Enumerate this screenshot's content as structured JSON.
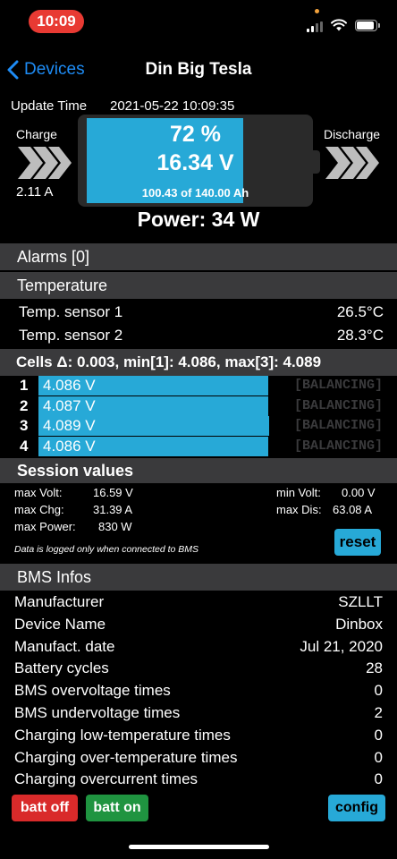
{
  "status_bar": {
    "time": "10:09"
  },
  "nav": {
    "back_label": "Devices",
    "title": "Din Big Tesla"
  },
  "summary": {
    "update_label": "Update Time",
    "update_value": "2021-05-22 10:09:35",
    "charge_label": "Charge",
    "charge_value": "2.11 A",
    "discharge_label": "Discharge",
    "percent": "72 %",
    "soc_fraction": 0.72,
    "voltage": "16.34 V",
    "capacity": "100.43 of 140.00 Ah",
    "power": "Power: 34 W"
  },
  "alarms": {
    "label": "Alarms [0]"
  },
  "temperature": {
    "label": "Temperature",
    "sensors": [
      {
        "name": "Temp. sensor 1",
        "value": "26.5°C"
      },
      {
        "name": "Temp. sensor 2",
        "value": "28.3°C"
      }
    ]
  },
  "cells": {
    "summary": "Cells Δ: 0.003, min[1]: 4.086, max[3]: 4.089",
    "items": [
      {
        "index": "1",
        "voltage": "4.086 V",
        "status": "[BALANCING]",
        "level": 0.675
      },
      {
        "index": "2",
        "voltage": "4.087 V",
        "status": "[BALANCING]",
        "level": 0.677
      },
      {
        "index": "3",
        "voltage": "4.089 V",
        "status": "[BALANCING]",
        "level": 0.68
      },
      {
        "index": "4",
        "voltage": "4.086 V",
        "status": "[BALANCING]",
        "level": 0.675
      }
    ]
  },
  "session": {
    "label": "Session values",
    "max_volt_label": "max Volt:",
    "max_volt": "16.59 V",
    "max_chg_label": "max Chg:",
    "max_chg": "31.39 A",
    "max_power_label": "max Power:",
    "max_power": "830 W",
    "min_volt_label": "min Volt:",
    "min_volt": "0.00 V",
    "max_dis_label": "max Dis:",
    "max_dis": "63.08 A",
    "note": "Data is logged only when connected to BMS",
    "reset_label": "reset"
  },
  "bms": {
    "label": "BMS Infos",
    "rows": [
      {
        "key": "Manufacturer",
        "value": "SZLLT"
      },
      {
        "key": "Device Name",
        "value": "Dinbox"
      },
      {
        "key": "Manufact. date",
        "value": "Jul 21, 2020"
      },
      {
        "key": "Battery cycles",
        "value": "28"
      },
      {
        "key": "BMS overvoltage times",
        "value": "0"
      },
      {
        "key": "BMS undervoltage times",
        "value": "2"
      },
      {
        "key": "Charging low-temperature times",
        "value": "0"
      },
      {
        "key": "Charging over-temperature times",
        "value": "0"
      },
      {
        "key": "Charging overcurrent times",
        "value": "0"
      }
    ]
  },
  "actions": {
    "batt_off": "batt off",
    "batt_on": "batt on",
    "config": "config"
  },
  "colors": {
    "accent": "#27a9d7",
    "section_bg": "#3a3a3c",
    "danger": "#d92a2a",
    "success": "#1f9440",
    "link": "#1e8cf5"
  }
}
